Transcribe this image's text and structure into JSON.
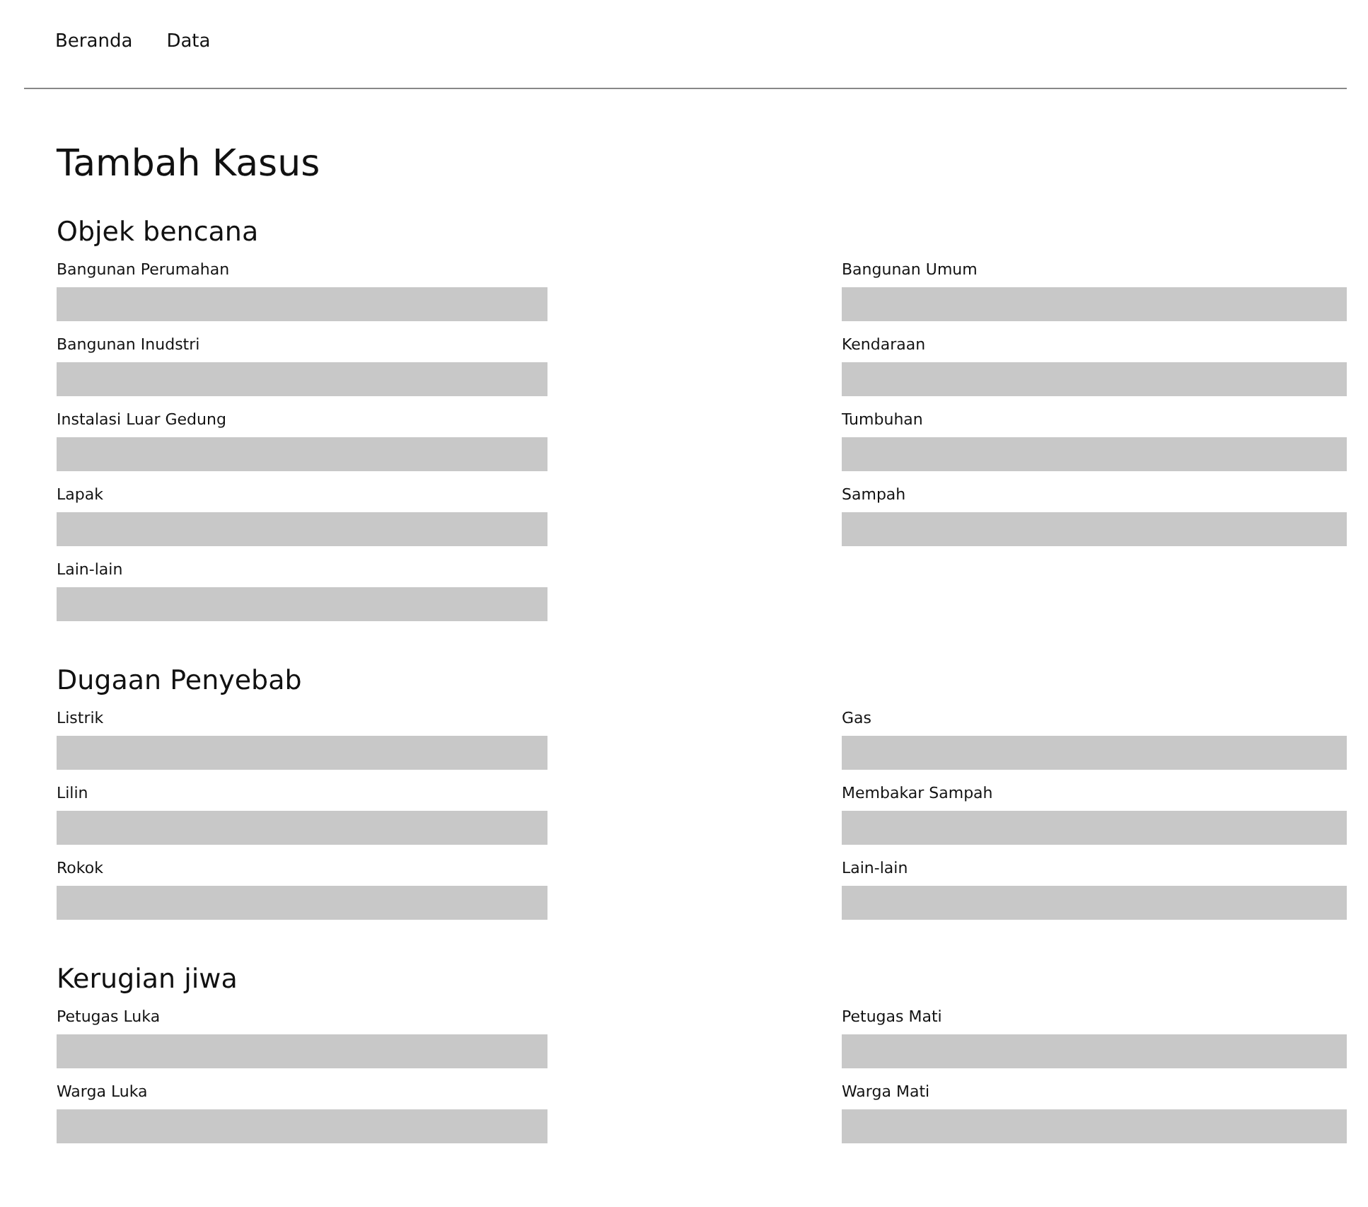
{
  "nav": {
    "items": [
      {
        "label": "Beranda"
      },
      {
        "label": "Data"
      }
    ]
  },
  "title": "Tambah Kasus",
  "sections": [
    {
      "title": "Objek bencana",
      "columns": [
        [
          {
            "label": "Bangunan Perumahan"
          },
          {
            "label": "Bangunan Inudstri"
          },
          {
            "label": "Instalasi Luar Gedung"
          },
          {
            "label": "Lapak"
          },
          {
            "label": "Lain-lain"
          }
        ],
        [
          {
            "label": "Bangunan Umum"
          },
          {
            "label": "Kendaraan"
          },
          {
            "label": "Tumbuhan"
          },
          {
            "label": "Sampah"
          }
        ]
      ]
    },
    {
      "title": "Dugaan Penyebab",
      "columns": [
        [
          {
            "label": "Listrik"
          },
          {
            "label": "Lilin"
          },
          {
            "label": "Rokok"
          }
        ],
        [
          {
            "label": "Gas"
          },
          {
            "label": "Membakar Sampah"
          },
          {
            "label": "Lain-lain"
          }
        ]
      ]
    },
    {
      "title": "Kerugian jiwa",
      "columns": [
        [
          {
            "label": "Petugas Luka"
          },
          {
            "label": "Warga Luka"
          }
        ],
        [
          {
            "label": "Petugas Mati"
          },
          {
            "label": "Warga Mati"
          }
        ]
      ]
    }
  ]
}
